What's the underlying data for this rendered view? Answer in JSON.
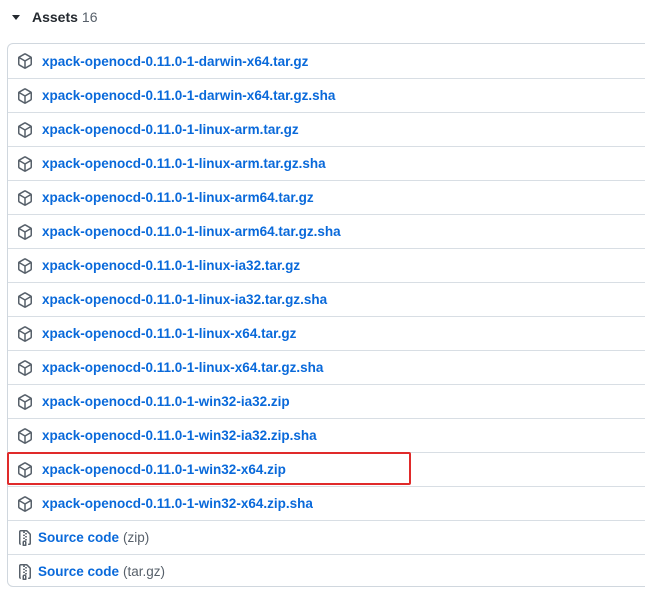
{
  "assets": {
    "title": "Assets",
    "count": "16",
    "files": [
      {
        "name": "xpack-openocd-0.11.0-1-darwin-x64.tar.gz",
        "icon": "package-icon"
      },
      {
        "name": "xpack-openocd-0.11.0-1-darwin-x64.tar.gz.sha",
        "icon": "package-icon"
      },
      {
        "name": "xpack-openocd-0.11.0-1-linux-arm.tar.gz",
        "icon": "package-icon"
      },
      {
        "name": "xpack-openocd-0.11.0-1-linux-arm.tar.gz.sha",
        "icon": "package-icon"
      },
      {
        "name": "xpack-openocd-0.11.0-1-linux-arm64.tar.gz",
        "icon": "package-icon"
      },
      {
        "name": "xpack-openocd-0.11.0-1-linux-arm64.tar.gz.sha",
        "icon": "package-icon"
      },
      {
        "name": "xpack-openocd-0.11.0-1-linux-ia32.tar.gz",
        "icon": "package-icon"
      },
      {
        "name": "xpack-openocd-0.11.0-1-linux-ia32.tar.gz.sha",
        "icon": "package-icon"
      },
      {
        "name": "xpack-openocd-0.11.0-1-linux-x64.tar.gz",
        "icon": "package-icon"
      },
      {
        "name": "xpack-openocd-0.11.0-1-linux-x64.tar.gz.sha",
        "icon": "package-icon"
      },
      {
        "name": "xpack-openocd-0.11.0-1-win32-ia32.zip",
        "icon": "package-icon"
      },
      {
        "name": "xpack-openocd-0.11.0-1-win32-ia32.zip.sha",
        "icon": "package-icon"
      },
      {
        "name": "xpack-openocd-0.11.0-1-win32-x64.zip",
        "icon": "package-icon"
      },
      {
        "name": "xpack-openocd-0.11.0-1-win32-x64.zip.sha",
        "icon": "package-icon"
      }
    ],
    "source": [
      {
        "label": "Source code",
        "suffix": "(zip)",
        "icon": "file-zip-icon"
      },
      {
        "label": "Source code",
        "suffix": "(tar.gz)",
        "icon": "file-zip-icon"
      }
    ]
  },
  "colors": {
    "link": "#0969da",
    "text": "#24292f",
    "muted": "#57606a",
    "border": "#d0d7de",
    "highlight": "#e02a2a"
  }
}
